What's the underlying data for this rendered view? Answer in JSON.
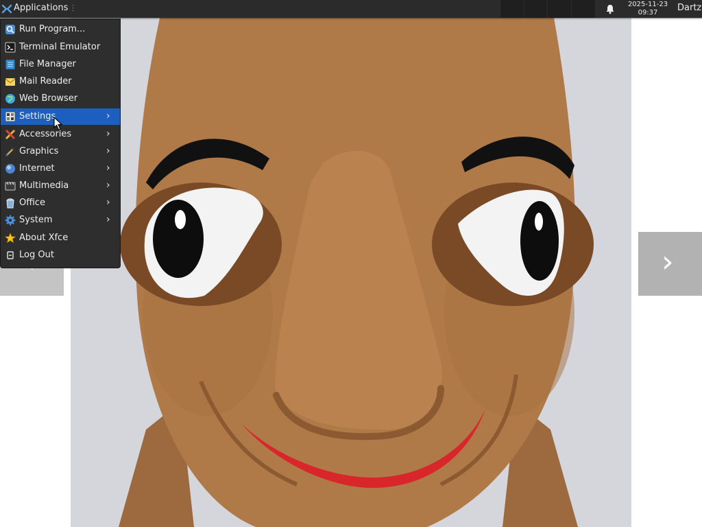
{
  "panel": {
    "applications_label": "Applications",
    "clock_date": "2025-11-23",
    "clock_time": "09:37",
    "user": "Dartz"
  },
  "menu": {
    "items": [
      {
        "label": "Run Program...",
        "icon": "run-program-icon",
        "submenu": false
      },
      {
        "label": "Terminal Emulator",
        "icon": "terminal-icon",
        "submenu": false
      },
      {
        "label": "File Manager",
        "icon": "file-manager-icon",
        "submenu": false
      },
      {
        "label": "Mail Reader",
        "icon": "mail-icon",
        "submenu": false
      },
      {
        "label": "Web Browser",
        "icon": "web-browser-icon",
        "submenu": false
      },
      {
        "label": "Settings",
        "icon": "settings-icon",
        "submenu": true,
        "highlighted": true
      },
      {
        "label": "Accessories",
        "icon": "accessories-icon",
        "submenu": true
      },
      {
        "label": "Graphics",
        "icon": "graphics-icon",
        "submenu": true
      },
      {
        "label": "Internet",
        "icon": "internet-icon",
        "submenu": true
      },
      {
        "label": "Multimedia",
        "icon": "multimedia-icon",
        "submenu": true
      },
      {
        "label": "Office",
        "icon": "office-icon",
        "submenu": true
      },
      {
        "label": "System",
        "icon": "system-icon",
        "submenu": true
      },
      {
        "label": "About Xfce",
        "icon": "star-icon",
        "submenu": false
      },
      {
        "label": "Log Out",
        "icon": "log-out-icon",
        "submenu": false
      }
    ]
  },
  "gallery": {
    "prev_glyph": "‹",
    "next_glyph": "›",
    "image_subject": "brown plush puppet face"
  },
  "colors": {
    "panel_bg": "#2b2b2b",
    "menu_bg": "#2e2e2e",
    "highlight": "#1c5fc0",
    "plush": "#b07a48",
    "lips": "#d8262a"
  }
}
